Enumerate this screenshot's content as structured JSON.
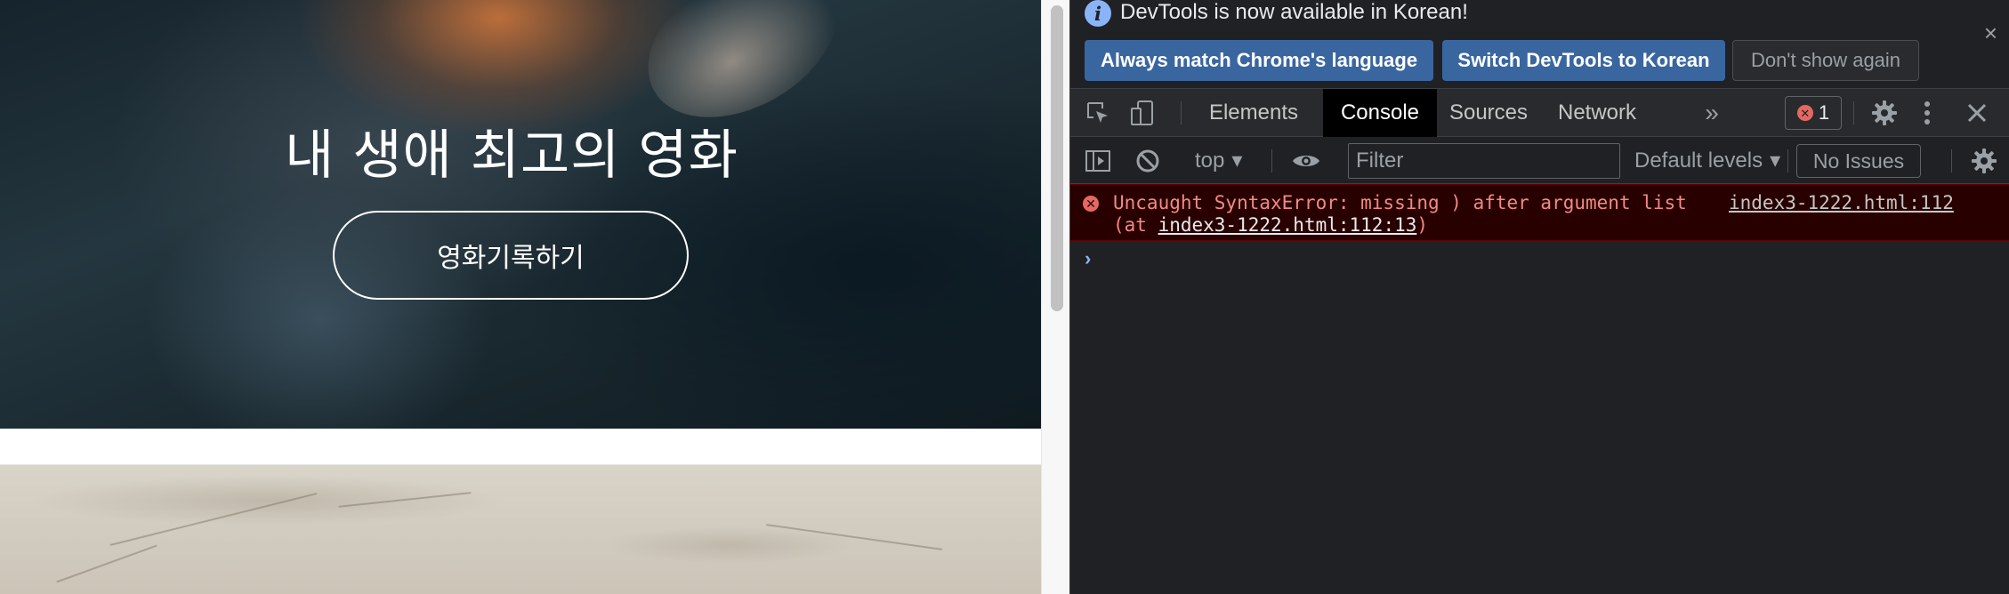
{
  "webpage": {
    "hero_title": "내 생애 최고의 영화",
    "hero_button": "영화기록하기"
  },
  "devtools": {
    "infobar": {
      "message": "DevTools is now available in Korean!",
      "btn_match": "Always match Chrome's language",
      "btn_switch": "Switch DevTools to Korean",
      "btn_dont_show": "Don't show again",
      "close_glyph": "×"
    },
    "tabs": [
      "Elements",
      "Console",
      "Sources",
      "Network"
    ],
    "active_tab": "Console",
    "more_tabs_glyph": "»",
    "error_count": "1",
    "console_toolbar": {
      "context": "top",
      "filter_placeholder": "Filter",
      "levels": "Default levels",
      "issues": "No Issues"
    },
    "console_error": {
      "message": "Uncaught SyntaxError: missing ) after argument list",
      "source_link": "index3-1222.html:112",
      "at_prefix": "(at ",
      "at_link": "index3-1222.html:112:13",
      "at_suffix": ")"
    },
    "prompt_glyph": "›"
  },
  "colors": {
    "devtools_bg": "#202124",
    "accent_blue": "#3a66a0",
    "error_bg": "#290000",
    "error_text": "#f28b82"
  },
  "icons": [
    "info-icon",
    "close-icon",
    "inspect-element-icon",
    "device-toolbar-icon",
    "more-tabs-icon",
    "error-icon",
    "gear-icon",
    "kebab-menu-icon",
    "sidebar-toggle-icon",
    "clear-console-icon",
    "eye-icon",
    "dropdown-arrow-icon",
    "prompt-caret-icon"
  ]
}
